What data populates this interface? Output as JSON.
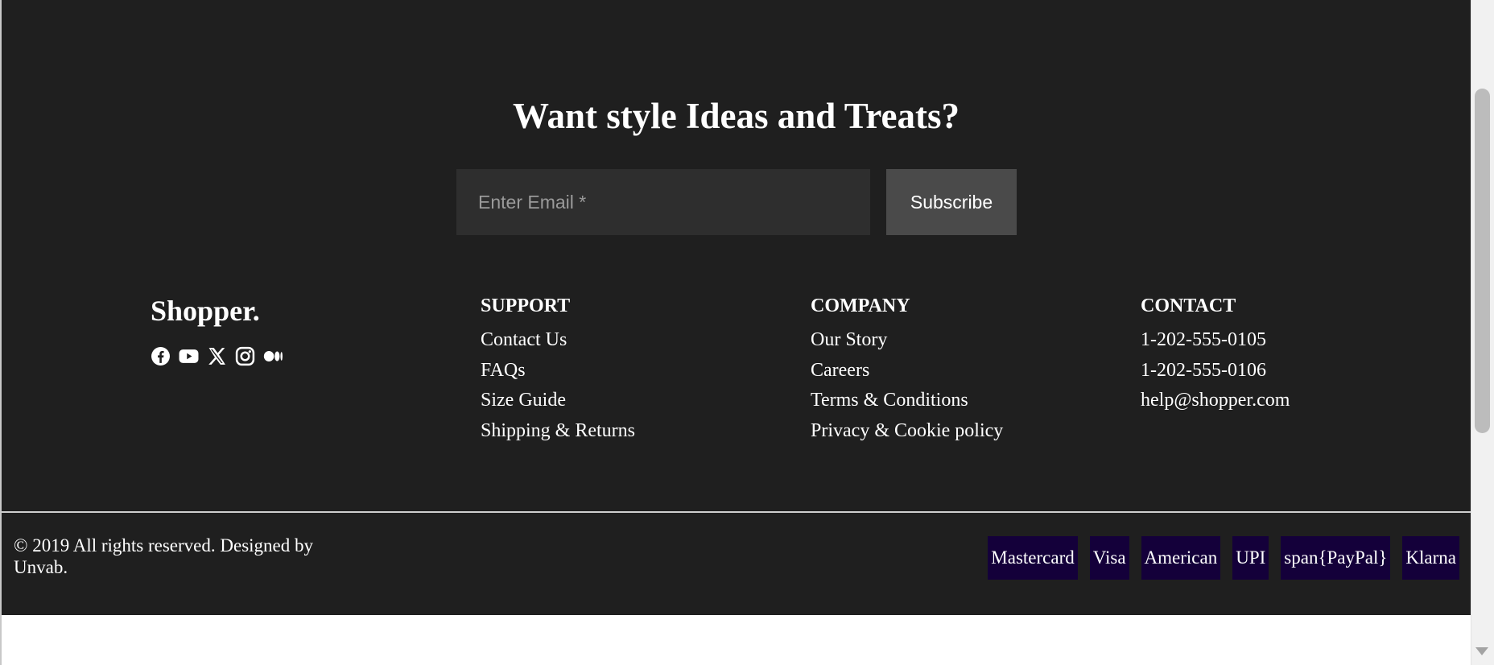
{
  "newsletter": {
    "title": "Want style Ideas and Treats?",
    "email_placeholder": "Enter Email *",
    "subscribe_label": "Subscribe"
  },
  "brand": {
    "name": "Shopper.",
    "socials": [
      "facebook-icon",
      "youtube-icon",
      "x-icon",
      "instagram-icon",
      "medium-icon"
    ]
  },
  "columns": {
    "support": {
      "heading": "SUPPORT",
      "links": [
        "Contact Us",
        "FAQs",
        "Size Guide",
        "Shipping & Returns"
      ]
    },
    "company": {
      "heading": "COMPANY",
      "links": [
        "Our Story",
        "Careers",
        "Terms & Conditions",
        "Privacy & Cookie policy"
      ]
    },
    "contact": {
      "heading": "CONTACT",
      "links": [
        "1-202-555-0105",
        "1-202-555-0106",
        "help@shopper.com"
      ]
    }
  },
  "bottom": {
    "copyright": "© 2019 All rights reserved. Designed by Unvab.",
    "payments": [
      "Mastercard",
      "Visa",
      "American",
      "UPI",
      "span{PayPal}",
      "Klarna"
    ]
  },
  "colors": {
    "footer_bg": "#1f1f1f",
    "input_bg": "#2e2e2e",
    "button_bg": "#4a4a4a",
    "payment_badge_bg": "#14003a",
    "text": "#ffffff"
  }
}
